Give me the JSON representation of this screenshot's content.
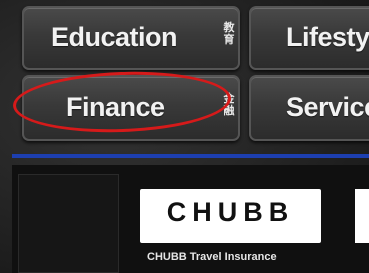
{
  "categories": [
    {
      "label": "Education",
      "cjk": "教育"
    },
    {
      "label": "Lifesty"
    },
    {
      "label": "Finance",
      "cjk": "金融"
    },
    {
      "label": "Service"
    }
  ],
  "partner": {
    "logo": "CHUBB",
    "caption": "CHUBB Travel Insurance"
  },
  "colors": {
    "accent_line": "#1d3fb0",
    "highlight_ring": "#d61a1a"
  }
}
